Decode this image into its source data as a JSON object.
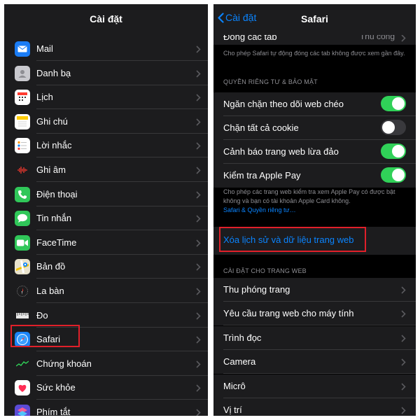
{
  "left": {
    "title": "Cài đặt",
    "items": [
      {
        "label": "Mail",
        "icon": "mail-icon",
        "color": "#1a7cf5"
      },
      {
        "label": "Danh bạ",
        "icon": "contacts-icon",
        "color": "#c9c9ce"
      },
      {
        "label": "Lịch",
        "icon": "calendar-icon",
        "color": "#ffffff"
      },
      {
        "label": "Ghi chú",
        "icon": "notes-icon",
        "color": "#ffffff"
      },
      {
        "label": "Lời nhắc",
        "icon": "reminders-icon",
        "color": "#ffffff"
      },
      {
        "label": "Ghi âm",
        "icon": "voice-memos-icon",
        "color": "#1c1c1e"
      },
      {
        "label": "Điện thoại",
        "icon": "phone-icon",
        "color": "#30c759"
      },
      {
        "label": "Tin nhắn",
        "icon": "messages-icon",
        "color": "#30c759"
      },
      {
        "label": "FaceTime",
        "icon": "facetime-icon",
        "color": "#30c759"
      },
      {
        "label": "Bản đồ",
        "icon": "maps-icon",
        "color": "#e9e3cc"
      },
      {
        "label": "La bàn",
        "icon": "compass-icon",
        "color": "#1c1c1e"
      },
      {
        "label": "Đo",
        "icon": "measure-icon",
        "color": "#1c1c1e"
      },
      {
        "label": "Safari",
        "icon": "safari-icon",
        "color": "#1a84f6"
      },
      {
        "label": "Chứng khoán",
        "icon": "stocks-icon",
        "color": "#1c1c1e"
      },
      {
        "label": "Sức khỏe",
        "icon": "health-icon",
        "color": "#ffffff"
      },
      {
        "label": "Phím tắt",
        "icon": "shortcuts-icon",
        "color": "#5b4bd6"
      }
    ]
  },
  "right": {
    "back_label": "Cài đặt",
    "title": "Safari",
    "close_tabs": {
      "label": "Đóng các tab",
      "value": "Thủ công"
    },
    "close_tabs_footer": "Cho phép Safari tự động đóng các tab không được xem gần đây.",
    "privacy_header": "QUYỀN RIÊNG TƯ & BẢO MẬT",
    "toggles": [
      {
        "label": "Ngăn chặn theo dõi web chéo",
        "on": true
      },
      {
        "label": "Chặn tất cả cookie",
        "on": false
      },
      {
        "label": "Cảnh báo trang web lừa đảo",
        "on": true
      },
      {
        "label": "Kiểm tra Apple Pay",
        "on": true
      }
    ],
    "privacy_footer": "Cho phép các trang web kiểm tra xem Apple Pay có được bật không và bạn có tài khoản Apple Card không.",
    "privacy_link": "Safari & Quyền riêng tư…",
    "clear_history": "Xóa lịch sử và dữ liệu trang web",
    "website_settings_header": "CÀI ĐẶT CHO TRANG WEB",
    "website_items": [
      {
        "label": "Thu phóng trang"
      },
      {
        "label": "Yêu cầu trang web cho máy tính"
      },
      {
        "label": "Trình đọc"
      },
      {
        "label": "Camera"
      },
      {
        "label": "Micrô"
      },
      {
        "label": "Vị trí"
      }
    ]
  },
  "colors": {
    "accent": "#0a84ff",
    "toggle_on": "#30d158",
    "highlight": "#e0202a"
  }
}
